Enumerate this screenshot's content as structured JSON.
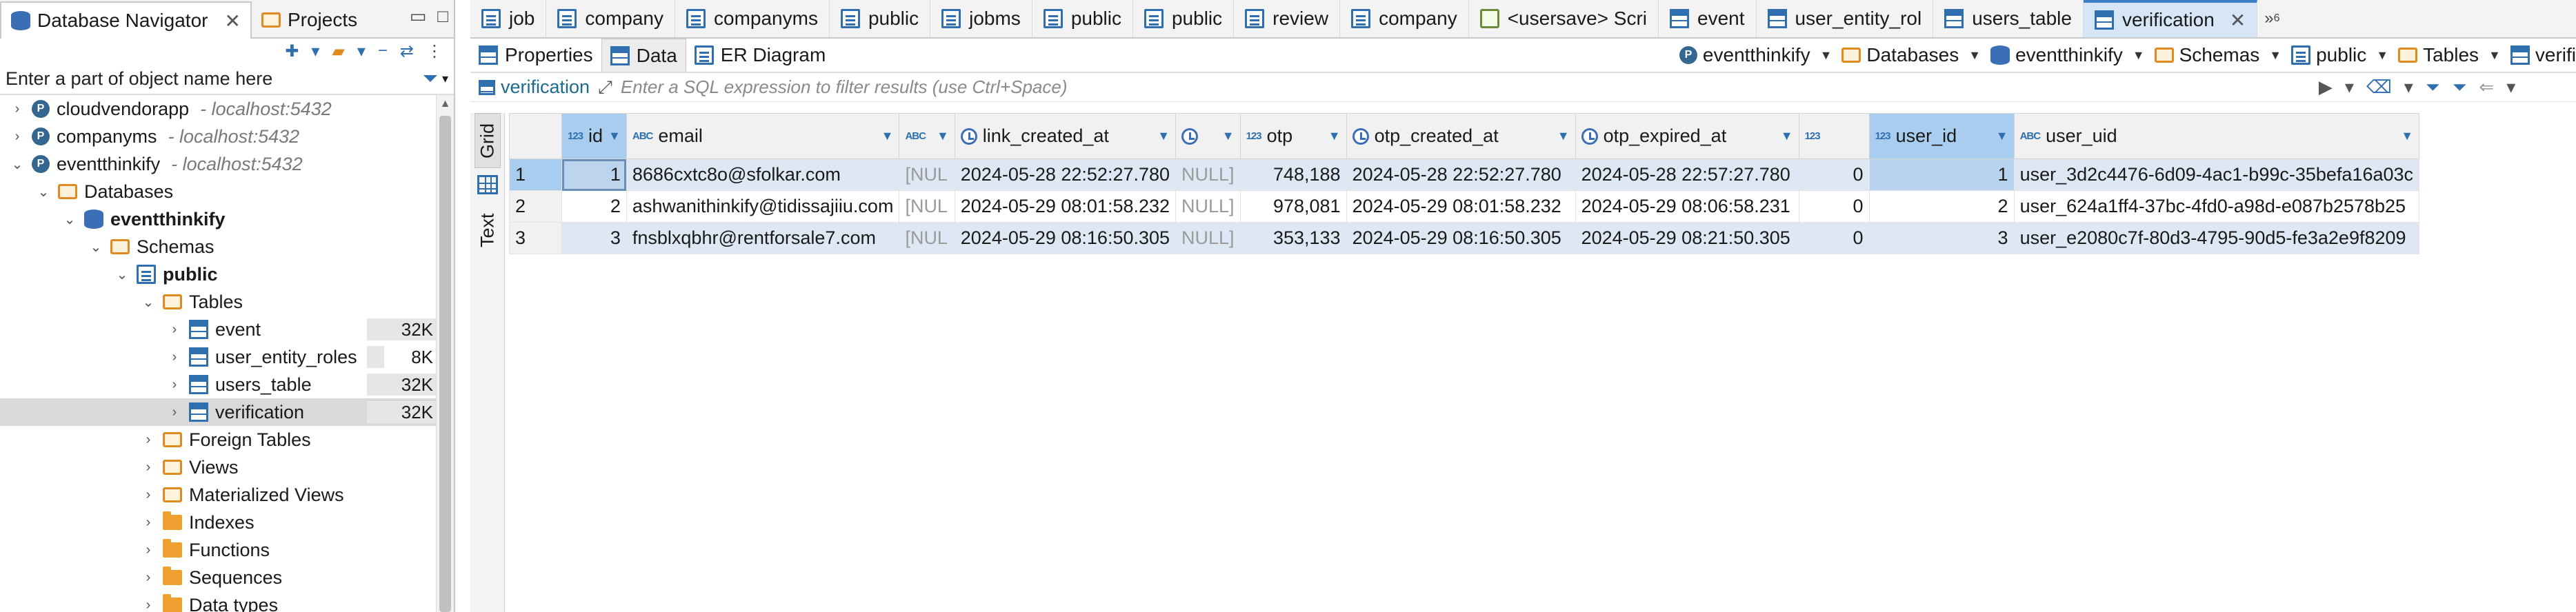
{
  "left_panel": {
    "tabs": [
      {
        "label": "Database Navigator",
        "active": true
      },
      {
        "label": "Projects",
        "active": false
      }
    ],
    "filter_placeholder": "Enter a part of object name here",
    "tree": [
      {
        "label": "cloudvendorapp",
        "host": "- localhost:5432",
        "level": 0,
        "icon": "postgres-icon",
        "twisty": "collapsed"
      },
      {
        "label": "companyms",
        "host": "- localhost:5432",
        "level": 0,
        "icon": "postgres-icon",
        "twisty": "collapsed"
      },
      {
        "label": "eventthinkify",
        "host": "- localhost:5432",
        "level": 0,
        "icon": "postgres-icon",
        "twisty": "expanded"
      },
      {
        "label": "Databases",
        "level": 1,
        "icon": "folder-link-icon",
        "twisty": "expanded"
      },
      {
        "label": "eventthinkify",
        "level": 2,
        "icon": "database-icon",
        "twisty": "expanded",
        "bold": true
      },
      {
        "label": "Schemas",
        "level": 3,
        "icon": "folder-link-icon",
        "twisty": "expanded"
      },
      {
        "label": "public",
        "level": 4,
        "icon": "schema-icon",
        "twisty": "expanded",
        "bold": true
      },
      {
        "label": "Tables",
        "level": 5,
        "icon": "folder-link-icon",
        "twisty": "expanded"
      },
      {
        "label": "event",
        "level": 6,
        "icon": "table-icon",
        "twisty": "collapsed",
        "size": "32K",
        "size_fraction": 1.0
      },
      {
        "label": "user_entity_roles",
        "level": 6,
        "icon": "table-icon",
        "twisty": "collapsed",
        "size": "8K",
        "size_fraction": 0.25
      },
      {
        "label": "users_table",
        "level": 6,
        "icon": "table-icon",
        "twisty": "collapsed",
        "size": "32K",
        "size_fraction": 1.0
      },
      {
        "label": "verification",
        "level": 6,
        "icon": "table-icon",
        "twisty": "collapsed",
        "size": "32K",
        "size_fraction": 1.0,
        "selected": true
      },
      {
        "label": "Foreign Tables",
        "level": 5,
        "icon": "folder-link-icon",
        "twisty": "collapsed"
      },
      {
        "label": "Views",
        "level": 5,
        "icon": "folder-link-icon",
        "twisty": "collapsed"
      },
      {
        "label": "Materialized Views",
        "level": 5,
        "icon": "folder-link-icon",
        "twisty": "collapsed"
      },
      {
        "label": "Indexes",
        "level": 5,
        "icon": "folder-icon",
        "twisty": "collapsed"
      },
      {
        "label": "Functions",
        "level": 5,
        "icon": "folder-icon",
        "twisty": "collapsed"
      },
      {
        "label": "Sequences",
        "level": 5,
        "icon": "folder-icon",
        "twisty": "collapsed"
      },
      {
        "label": "Data types",
        "level": 5,
        "icon": "folder-icon",
        "twisty": "collapsed"
      }
    ]
  },
  "editor_tabs": [
    {
      "label": "job",
      "icon": "schema-icon"
    },
    {
      "label": "company",
      "icon": "schema-icon"
    },
    {
      "label": "companyms",
      "icon": "schema-icon"
    },
    {
      "label": "public",
      "icon": "schema-icon"
    },
    {
      "label": "jobms",
      "icon": "schema-icon"
    },
    {
      "label": "public",
      "icon": "schema-icon"
    },
    {
      "label": "public",
      "icon": "schema-icon"
    },
    {
      "label": "review",
      "icon": "schema-icon"
    },
    {
      "label": "company",
      "icon": "schema-icon"
    },
    {
      "label": "<usersave> Scri",
      "icon": "script-icon"
    },
    {
      "label": "event",
      "icon": "table-icon"
    },
    {
      "label": "user_entity_rol",
      "icon": "table-icon"
    },
    {
      "label": "users_table",
      "icon": "table-icon"
    },
    {
      "label": "verification",
      "icon": "table-icon",
      "active": true
    }
  ],
  "editor_tabs_more": "»",
  "editor_tabs_more_count": "6",
  "sub_tabs": [
    {
      "label": "Properties",
      "icon": "properties-icon"
    },
    {
      "label": "Data",
      "icon": "data-icon",
      "active": true
    },
    {
      "label": "ER Diagram",
      "icon": "er-diagram-icon"
    }
  ],
  "context": [
    {
      "label": "eventthinkify",
      "icon": "postgres-icon"
    },
    {
      "label": "Databases",
      "icon": "folder-link-icon"
    },
    {
      "label": "eventthinkify",
      "icon": "database-icon"
    },
    {
      "label": "Schemas",
      "icon": "folder-link-icon"
    },
    {
      "label": "public",
      "icon": "schema-icon"
    },
    {
      "label": "Tables",
      "icon": "folder-link-icon"
    },
    {
      "label": "verifi",
      "icon": "table-icon"
    }
  ],
  "filter_bar": {
    "table_name": "verification",
    "placeholder": "Enter a SQL expression to filter results (use Ctrl+Space)"
  },
  "view_tabs": {
    "grid": "Grid",
    "text": "Text"
  },
  "grid": {
    "columns": [
      {
        "name": "id",
        "type": "123",
        "sort": true,
        "selected": true
      },
      {
        "name": "email",
        "type": "ABC",
        "sort": true
      },
      {
        "name": "",
        "type": "ABC",
        "sort": true
      },
      {
        "name": "link_created_at",
        "type": "clock",
        "sort": true
      },
      {
        "name": "",
        "type": "clock",
        "sort": true
      },
      {
        "name": "otp",
        "type": "123",
        "sort": true
      },
      {
        "name": "otp_created_at",
        "type": "clock",
        "sort": true
      },
      {
        "name": "otp_expired_at",
        "type": "clock",
        "sort": true
      },
      {
        "name": "",
        "type": "123",
        "sort": false
      },
      {
        "name": "user_id",
        "type": "123",
        "sort": true,
        "selected": true
      },
      {
        "name": "user_uid",
        "type": "ABC",
        "sort": true
      }
    ],
    "rows": [
      {
        "rownum": "1",
        "cells": [
          "1",
          "8686cxtc8o@sfolkar.com",
          "[NUL",
          "2024-05-28 22:52:27.780",
          "NULL]",
          "748,188",
          "2024-05-28 22:52:27.780",
          "2024-05-28 22:57:27.780",
          "0",
          "1",
          "user_3d2c4476-6d09-4ac1-b99c-35befa16a03c"
        ]
      },
      {
        "rownum": "2",
        "cells": [
          "2",
          "ashwanithinkify@tidissajiiu.com",
          "[NUL",
          "2024-05-29 08:01:58.232",
          "NULL]",
          "978,081",
          "2024-05-29 08:01:58.232",
          "2024-05-29 08:06:58.231",
          "0",
          "2",
          "user_624a1ff4-37bc-4fd0-a98d-e087b2578b25"
        ]
      },
      {
        "rownum": "3",
        "cells": [
          "3",
          "fnsblxqbhr@rentforsale7.com",
          "[NUL",
          "2024-05-29 08:16:50.305",
          "NULL]",
          "353,133",
          "2024-05-29 08:16:50.305",
          "2024-05-29 08:21:50.305",
          "0",
          "3",
          "user_e2080c7f-80d3-4795-90d5-fe3a2e9f8209"
        ]
      }
    ]
  },
  "colors": {
    "accent": "#3c7fc7",
    "selection": "#a9cdee",
    "row_stripe": "#dde8f4",
    "tree_selection": "#d9d9d9"
  }
}
